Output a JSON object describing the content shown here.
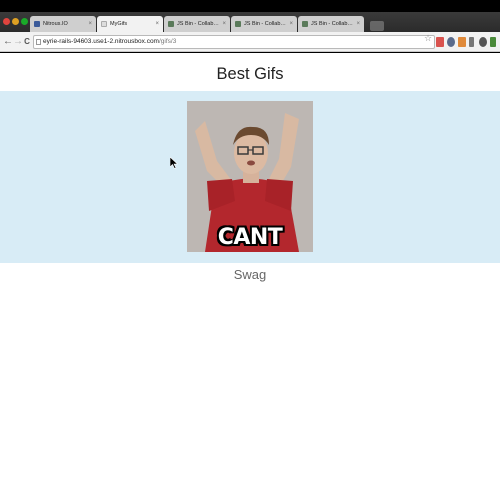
{
  "browser": {
    "tabs": [
      {
        "label": "Nitrous.IO",
        "active": false,
        "favicon_color": "#3b5b9a"
      },
      {
        "label": "MyGifs",
        "active": true,
        "favicon_color": "#dddddd"
      },
      {
        "label": "JS Bin - Collaborative JavaS",
        "active": false,
        "favicon_color": "#5a7a5a"
      },
      {
        "label": "JS Bin - Collaborative JavaS",
        "active": false,
        "favicon_color": "#5a7a5a"
      },
      {
        "label": "JS Bin - Collaborative JavaS",
        "active": false,
        "favicon_color": "#5a7a5a"
      }
    ],
    "url": {
      "host": "eyrie-rails-94603.use1-2.nitrousbox.com",
      "path": "/gifs/3"
    },
    "nav": {
      "back": "←",
      "forward": "→",
      "reload": "C"
    }
  },
  "page": {
    "title": "Best Gifs",
    "gif": {
      "caption_overlay": "CANT"
    },
    "caption": "Swag"
  },
  "colors": {
    "band": "#d8ecf6",
    "page_background": "#ffffff",
    "gif_shirt": "#b3272d"
  }
}
